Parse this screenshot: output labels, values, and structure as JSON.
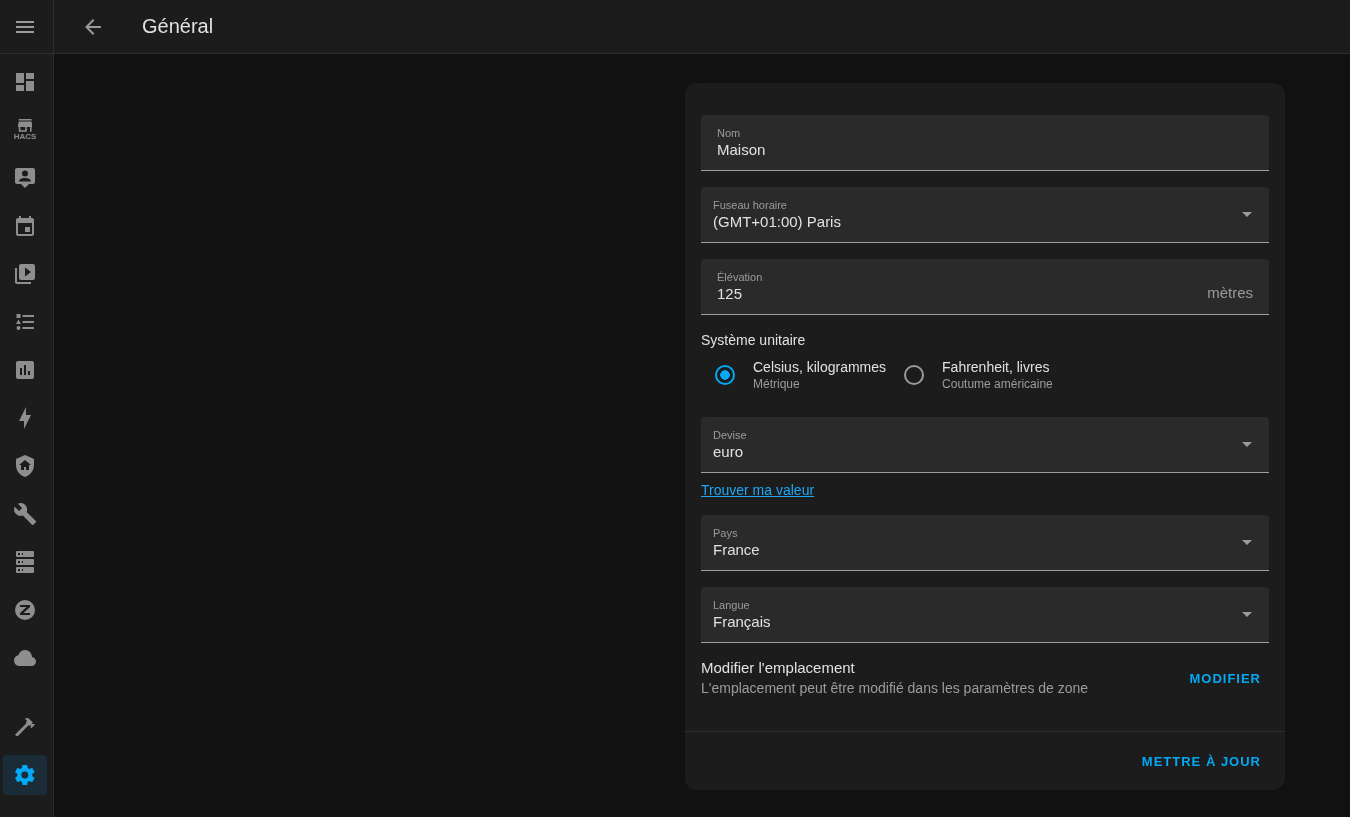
{
  "sidebar": {
    "main_items": [
      {
        "selected": false
      },
      {
        "selected": false,
        "caption": "HACS"
      },
      {
        "selected": false
      },
      {
        "selected": false
      },
      {
        "selected": false
      },
      {
        "selected": false
      },
      {
        "selected": false
      },
      {
        "selected": false
      },
      {
        "selected": false
      },
      {
        "selected": false
      },
      {
        "selected": false
      },
      {
        "selected": false
      },
      {
        "selected": false
      }
    ],
    "bottom_items": [
      {
        "selected": false
      },
      {
        "selected": true
      }
    ]
  },
  "header": {
    "title": "Général"
  },
  "form": {
    "items": [
      {
        "kind": "text_field",
        "label": "Nom",
        "value": "Maison"
      },
      {
        "kind": "select_field",
        "label": "Fuseau horaire",
        "value": "(GMT+01:00) Paris"
      },
      {
        "kind": "text_field",
        "label": "Élévation",
        "value": "125",
        "suffix": "mètres"
      },
      {
        "kind": "radio_group",
        "title": "Système unitaire",
        "options": [
          {
            "label": "Celsius, kilogrammes",
            "description": "Métrique",
            "selected": true
          },
          {
            "label": "Fahrenheit, livres",
            "description": "Coutume américaine",
            "selected": false
          }
        ]
      },
      {
        "kind": "select_field",
        "label": "Devise",
        "value": "euro"
      },
      {
        "kind": "link",
        "text": "Trouver ma valeur"
      },
      {
        "kind": "select_field",
        "label": "Pays",
        "value": "France"
      },
      {
        "kind": "select_field",
        "label": "Langue",
        "value": "Français"
      }
    ],
    "location": {
      "title": "Modifier l'emplacement",
      "description": "L'emplacement peut être modifié dans les paramètres de zone",
      "button": "MODIFIER"
    },
    "footer": {
      "button": "METTRE À JOUR"
    }
  }
}
